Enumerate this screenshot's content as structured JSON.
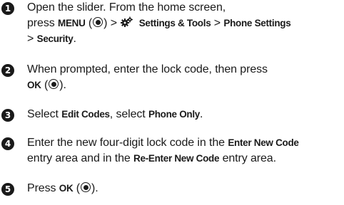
{
  "steps": [
    {
      "number": "1",
      "line1": "Open the slider. From the home screen,",
      "press": "press",
      "menu": "MENU",
      "open_paren": "(",
      "close_paren": ") >",
      "settings_tools": "Settings & Tools",
      "sep": ">",
      "phone_settings": "Phone Settings",
      "line3_prefix": ">",
      "security": "Security",
      "line3_suffix": "."
    },
    {
      "number": "2",
      "line1": "When prompted, enter the lock code, then press",
      "ok": "OK",
      "open_paren": "(",
      "close_paren": ")."
    },
    {
      "number": "3",
      "select1": "Select",
      "edit_codes": "Edit Codes",
      "select2": ", select",
      "phone_only": "Phone Only",
      "end": "."
    },
    {
      "number": "4",
      "part1": "Enter the new four-digit lock code in the",
      "enter_new_code": "Enter New Code",
      "part2": "entry area and in the",
      "reenter_new_code": "Re-Enter New Code",
      "part3": "entry area."
    },
    {
      "number": "5",
      "press": "Press",
      "ok": "OK",
      "open_paren": "(",
      "close_paren": ")."
    }
  ],
  "icons": {
    "step_number": "filled-circle-number-icon",
    "center_key": "center-select-key-icon",
    "settings": "settings-gear-icon"
  }
}
